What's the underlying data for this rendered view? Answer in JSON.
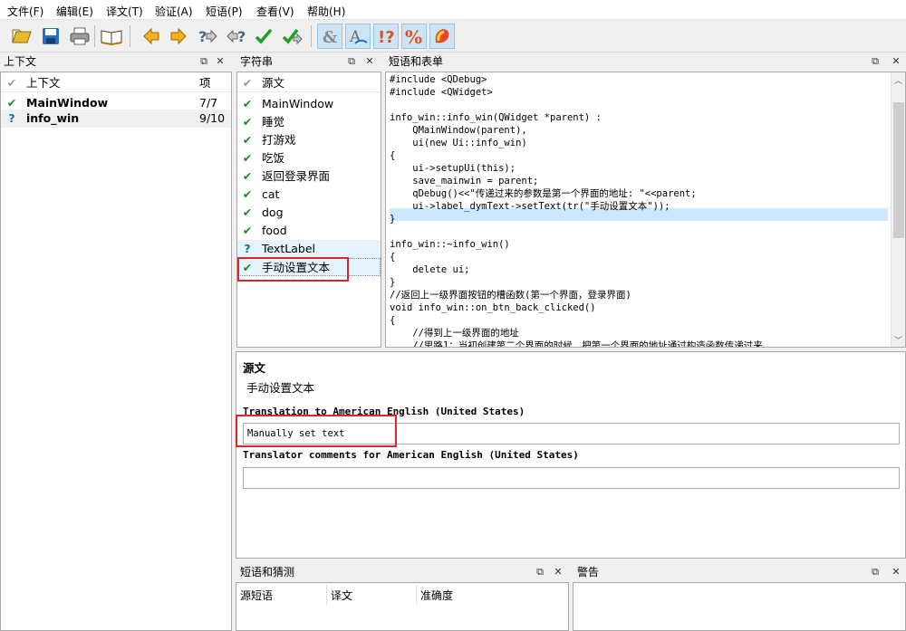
{
  "menu": [
    "文件(F)",
    "编辑(E)",
    "译文(T)",
    "验证(A)",
    "短语(P)",
    "查看(V)",
    "帮助(H)"
  ],
  "toolbar": [
    "open-icon",
    "save-icon",
    "print-icon",
    "phrasebook-icon",
    "prev-icon",
    "next-icon",
    "prev-unfinished-icon",
    "next-unfinished-icon",
    "done-icon",
    "done-next-icon",
    "accelerator-check-icon",
    "phrase-check-icon",
    "punctuation-check-icon",
    "placemarker-check-icon",
    "surrounding-whitespace-icon"
  ],
  "context": {
    "title": "上下文",
    "col_name": "上下文",
    "col_items": "项",
    "rows": [
      {
        "name": "MainWindow",
        "count": "7/7",
        "status": "done"
      },
      {
        "name": "info_win",
        "count": "9/10",
        "status": "unfinished"
      }
    ]
  },
  "strings": {
    "title": "字符串",
    "header": "源文",
    "rows": [
      {
        "text": "MainWindow",
        "status": "done"
      },
      {
        "text": "睡觉",
        "status": "done"
      },
      {
        "text": "打游戏",
        "status": "done"
      },
      {
        "text": "吃饭",
        "status": "done"
      },
      {
        "text": "返回登录界面",
        "status": "done"
      },
      {
        "text": "cat",
        "status": "done"
      },
      {
        "text": "dog",
        "status": "done"
      },
      {
        "text": "food",
        "status": "done"
      },
      {
        "text": "TextLabel",
        "status": "unfinished"
      },
      {
        "text": "手动设置文本",
        "status": "done"
      }
    ]
  },
  "code_panel": {
    "title": "短语和表单",
    "lines": [
      "#include <QDebug>",
      "#include <QWidget>",
      "",
      "info_win::info_win(QWidget *parent) :",
      "    QMainWindow(parent),",
      "    ui(new Ui::info_win)",
      "{",
      "    ui->setupUi(this);",
      "    save_mainwin = parent;",
      "    qDebug()<<\"传递过来的参数是第一个界面的地址: \"<<parent;",
      "    ui->label_dymText->setText(tr(\"手动设置文本\"));",
      "}",
      "",
      "info_win::~info_win()",
      "{",
      "    delete ui;",
      "}",
      "//返回上一级界面按钮的槽函数(第一个界面，登录界面)",
      "void info_win::on_btn_back_clicked()",
      "{",
      "    //得到上一级界面的地址",
      "    //思路1：当初创建第二个界面的时候，把第一个界面的地址通过构造函数传递过来"
    ]
  },
  "editor": {
    "source_label": "源文",
    "source_text": "手动设置文本",
    "translation_label": "Translation to American English (United States)",
    "translation_value": "Manually set text",
    "comments_label": "Translator comments for American English (United States)",
    "comments_value": ""
  },
  "phrases": {
    "title": "短语和猜测",
    "cols": [
      "源短语",
      "译文",
      "准确度"
    ]
  },
  "warnings": {
    "title": "警告"
  },
  "colors": {
    "done": "#1e8a1e",
    "unfinished": "#1e6e8c",
    "highlight": "#cce8ff",
    "selected": "#e5f3ff",
    "red": "#e0242c"
  }
}
